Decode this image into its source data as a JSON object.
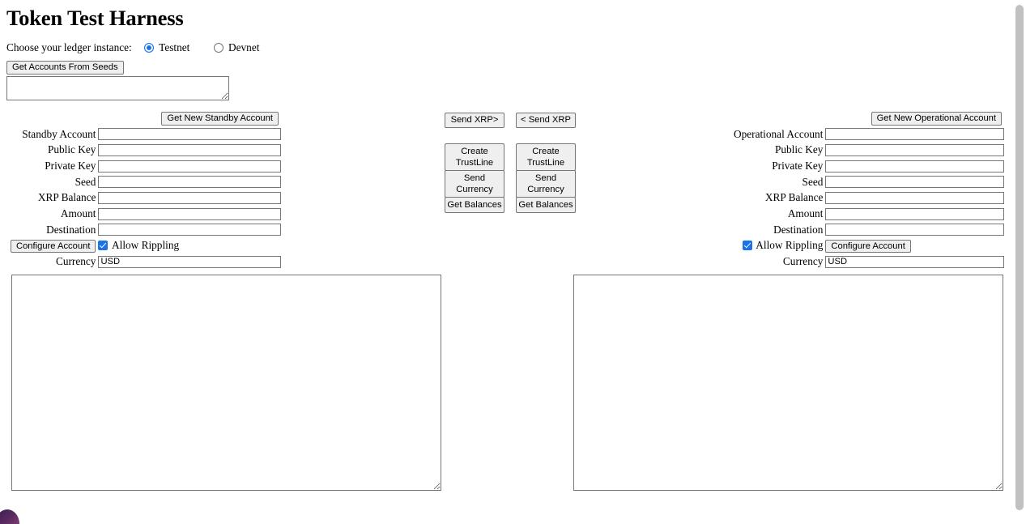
{
  "page": {
    "title": "Token Test Harness"
  },
  "ledger": {
    "prompt": "Choose your ledger instance:",
    "options": [
      {
        "label": "Testnet",
        "selected": true
      },
      {
        "label": "Devnet",
        "selected": false
      }
    ]
  },
  "seeds": {
    "button_label": "Get Accounts From Seeds",
    "textarea_value": "",
    "textarea_placeholder": ""
  },
  "standby": {
    "new_account_button": "Get New Standby Account",
    "fields": [
      {
        "label": "Standby Account",
        "value": ""
      },
      {
        "label": "Public Key",
        "value": ""
      },
      {
        "label": "Private Key",
        "value": ""
      },
      {
        "label": "Seed",
        "value": ""
      },
      {
        "label": "XRP Balance",
        "value": ""
      },
      {
        "label": "Amount",
        "value": ""
      },
      {
        "label": "Destination",
        "value": ""
      }
    ],
    "configure_button": "Configure Account",
    "rippling_label": "Allow Rippling",
    "rippling_checked": true,
    "currency_label": "Currency",
    "currency_value": "USD",
    "output_value": ""
  },
  "center": {
    "send_xrp_right": "Send XRP>",
    "send_xrp_left": "< Send XRP",
    "left_stack": [
      "Create TrustLine",
      "Send Currency",
      "Get Balances"
    ],
    "right_stack": [
      "Create TrustLine",
      "Send Currency",
      "Get Balances"
    ]
  },
  "operational": {
    "new_account_button": "Get New Operational Account",
    "fields": [
      {
        "label": "Operational Account",
        "value": ""
      },
      {
        "label": "Public Key",
        "value": ""
      },
      {
        "label": "Private Key",
        "value": ""
      },
      {
        "label": "Seed",
        "value": ""
      },
      {
        "label": "XRP Balance",
        "value": ""
      },
      {
        "label": "Amount",
        "value": ""
      },
      {
        "label": "Destination",
        "value": ""
      }
    ],
    "configure_button": "Configure Account",
    "rippling_label": "Allow Rippling",
    "rippling_checked": true,
    "currency_label": "Currency",
    "currency_value": "USD",
    "output_value": ""
  },
  "colors": {
    "accent": "#1a73e8",
    "button_face": "#efefef",
    "button_border": "#767676",
    "field_border": "#767676",
    "scrollbar_thumb": "#c1c1c1"
  }
}
